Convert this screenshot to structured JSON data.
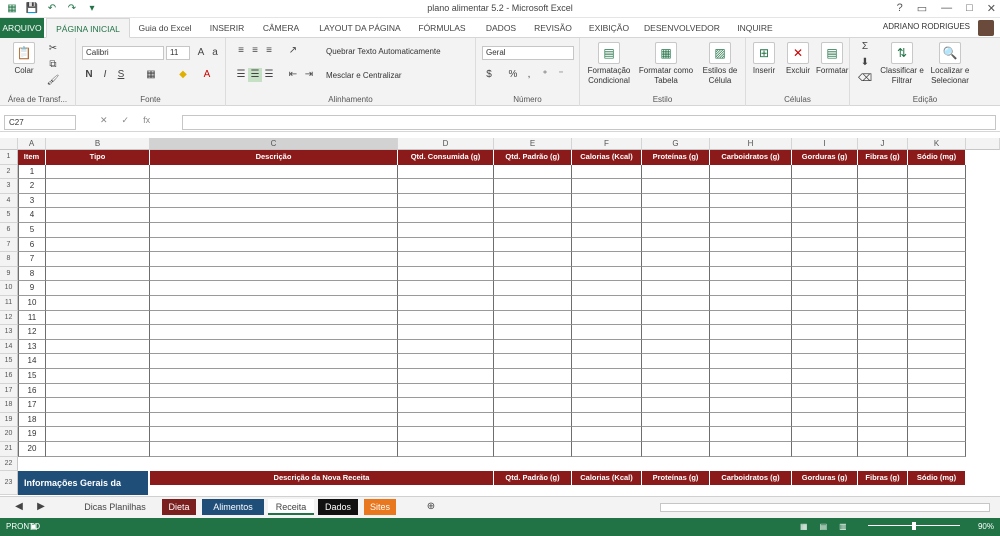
{
  "window": {
    "title": "plano alimentar 5.2 - Microsoft Excel"
  },
  "qat": {
    "save_icon": "save-icon",
    "undo_icon": "undo-icon",
    "redo_icon": "redo-icon"
  },
  "window_controls": [
    "?",
    "▭",
    "—",
    "□",
    "✕"
  ],
  "ribbon_tabs": [
    "ARQUIVO",
    "PÁGINA INICIAL",
    "Guia do Excel",
    "INSERIR",
    "CÂMERA",
    "LAYOUT DA PÁGINA",
    "FÓRMULAS",
    "DADOS",
    "REVISÃO",
    "EXIBIÇÃO",
    "DESENVOLVEDOR",
    "INQUIRE"
  ],
  "user": {
    "name": "ADRIANO RODRIGUES"
  },
  "ribbon": {
    "clipboard": {
      "paste": "Colar",
      "label": "Área de Transf..."
    },
    "font": {
      "name": "Calibri",
      "size": "11",
      "bold": "N",
      "italic": "I",
      "underline": "S",
      "label": "Fonte"
    },
    "alignment": {
      "wrap": "Quebrar Texto Automaticamente",
      "merge": "Mesclar e Centralizar",
      "label": "Alinhamento"
    },
    "number": {
      "format": "Geral",
      "label": "Número"
    },
    "styles": {
      "conditional": "Formatação Condicional",
      "table": "Formatar como Tabela",
      "cell": "Estilos de Célula",
      "label": "Estilo"
    },
    "cells": {
      "insert": "Inserir",
      "delete": "Excluir",
      "format": "Formatar",
      "label": "Células"
    },
    "editing": {
      "sort": "Classificar e Filtrar",
      "find": "Localizar e Selecionar",
      "label": "Edição"
    }
  },
  "formula_bar": {
    "name_box": "C27",
    "formula": ""
  },
  "columns": [
    "A",
    "B",
    "C",
    "D",
    "E",
    "F",
    "G",
    "H",
    "I",
    "J",
    "K"
  ],
  "table": {
    "headers": [
      "Item",
      "Tipo",
      "Descrição",
      "Qtd. Consumida (g)",
      "Qtd. Padrão (g)",
      "Calorias (Kcal)",
      "Proteínas (g)",
      "Carboidratos (g)",
      "Gorduras (g)",
      "Fibras (g)",
      "Sódio (mg)"
    ],
    "items": [
      "1",
      "2",
      "3",
      "4",
      "5",
      "6",
      "7",
      "8",
      "9",
      "10",
      "11",
      "12",
      "13",
      "14",
      "15",
      "16",
      "17",
      "18",
      "19",
      "20"
    ]
  },
  "rows": [
    "1",
    "2",
    "3",
    "4",
    "5",
    "6",
    "7",
    "8",
    "9",
    "10",
    "11",
    "12",
    "13",
    "14",
    "15",
    "16",
    "17",
    "18",
    "19",
    "20",
    "21",
    "22",
    "23"
  ],
  "section2": {
    "title": "Informações Gerais da",
    "headers": [
      "Descrição da Nova Receita",
      "Qtd. Padrão (g)",
      "Calorias (Kcal)",
      "Proteínas (g)",
      "Carboidratos (g)",
      "Gorduras (g)",
      "Fibras (g)",
      "Sódio (mg)"
    ]
  },
  "sheets": {
    "tabs": [
      "Dicas Planilhas",
      "Dieta",
      "Alimentos",
      "Receita",
      "Dados",
      "Sites"
    ],
    "colors": [
      "#f3f3f3",
      "#7b1f1f",
      "#1f4e79",
      "#ffffff",
      "#111111",
      "#e8771e"
    ]
  },
  "status": {
    "ready": "PRONTO",
    "zoom": "90%"
  }
}
